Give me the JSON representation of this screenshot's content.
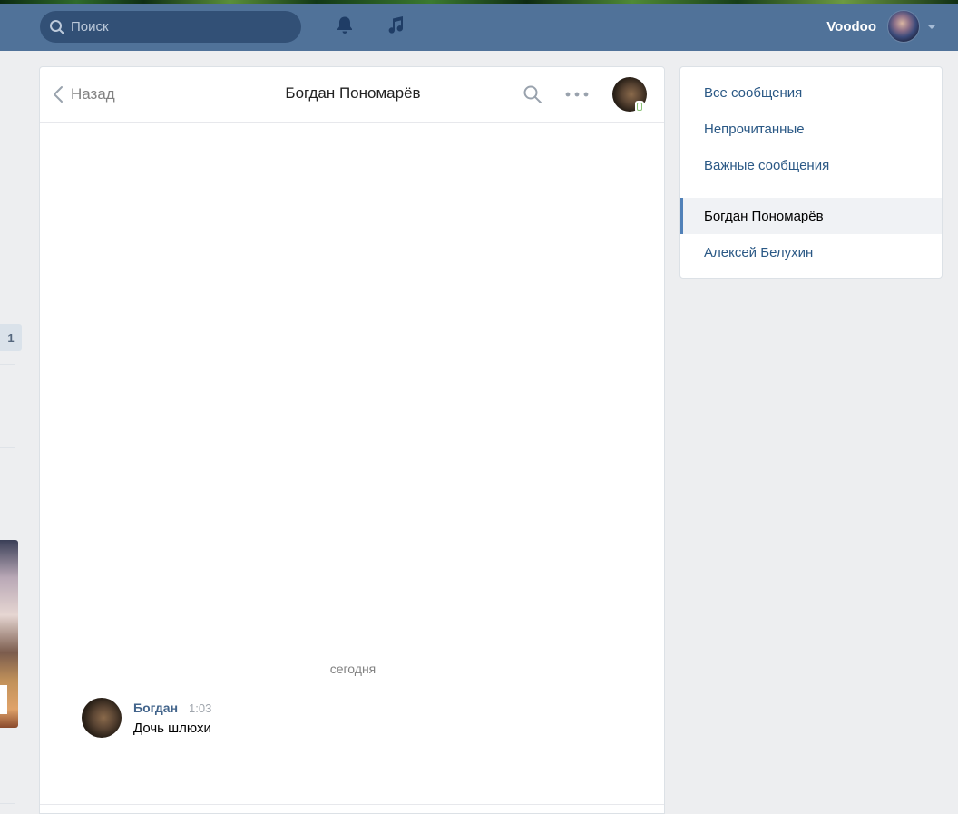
{
  "header": {
    "search": {
      "placeholder": "Поиск",
      "value": ""
    },
    "user_name": "Voodoo",
    "icons": [
      "search-icon",
      "bell-icon",
      "music-icon",
      "chevron-down-icon"
    ]
  },
  "left_fragment": {
    "badge_count": "1"
  },
  "chat": {
    "back_label": "Назад",
    "title": "Богдан Пономарёв",
    "day_divider": "сегодня",
    "messages": [
      {
        "author": "Богдан",
        "time": "1:03",
        "text": "Дочь шлюхи"
      }
    ]
  },
  "right_nav": {
    "items": [
      {
        "label": "Все сообщения"
      },
      {
        "label": "Непрочитанные"
      },
      {
        "label": "Важные сообщения"
      }
    ],
    "conversations": [
      {
        "label": "Богдан Пономарёв",
        "active": true
      },
      {
        "label": "Алексей Белухин",
        "active": false
      }
    ]
  },
  "colors": {
    "header_bg": "#507299",
    "link": "#2a5885",
    "author": "#42648b",
    "page_bg": "#edeef0"
  }
}
